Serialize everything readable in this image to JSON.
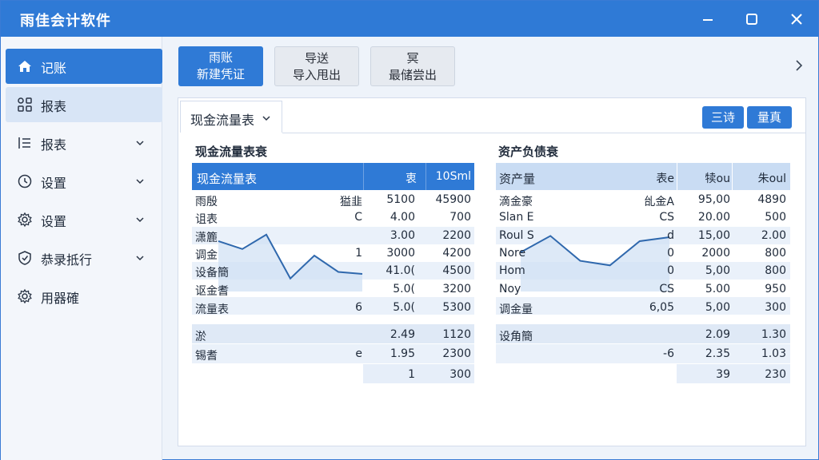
{
  "window": {
    "title": "雨佳会计软件",
    "controls": [
      "minimize-icon",
      "maximize-icon",
      "close-icon"
    ]
  },
  "sidebar": {
    "items": [
      {
        "label": "记账",
        "icon": "home-icon",
        "state": "active",
        "has_chevron": false
      },
      {
        "label": "报表",
        "icon": "grid-icon",
        "state": "selected",
        "has_chevron": false
      },
      {
        "label": "报表",
        "icon": "list-icon",
        "state": "normal",
        "has_chevron": true
      },
      {
        "label": "设置",
        "icon": "clock-icon",
        "state": "normal",
        "has_chevron": true
      },
      {
        "label": "设置",
        "icon": "gear-icon",
        "state": "normal",
        "has_chevron": true
      },
      {
        "label": "恭录抵行",
        "icon": "shield-icon",
        "state": "normal",
        "has_chevron": true
      },
      {
        "label": "用器確",
        "icon": "gear-icon",
        "state": "normal",
        "has_chevron": false
      }
    ]
  },
  "toolbar": {
    "new_voucher": {
      "line1": "雨账",
      "line2": "新建凭证"
    },
    "import_export": {
      "line1": "导送",
      "line2": "导入甩出"
    },
    "extra": {
      "line1": "冥",
      "line2": "最储尝出"
    }
  },
  "report": {
    "selector_label": "现金流量表",
    "btn_a": "三诗",
    "btn_b": "量真"
  },
  "cash_flow": {
    "section_title": "现金流量表衰",
    "header": [
      "现金流量表",
      "",
      "衷",
      "10Sml"
    ],
    "rows": [
      [
        "雨殷",
        "獈韭",
        "5100",
        "45900"
      ],
      [
        "诅表",
        "C",
        "4.00",
        "700"
      ],
      [
        "潇簏",
        "",
        "3.00",
        "2200"
      ],
      [
        "调金",
        "1",
        "3000",
        "4200"
      ],
      [
        "设备簡",
        "",
        "41.0(",
        "4500"
      ],
      [
        "讴金耆",
        "",
        "5.0(",
        "3200"
      ],
      [
        "流量表",
        "6",
        "5.0(",
        "5300"
      ]
    ],
    "totals": [
      [
        "淤",
        "",
        "2.49",
        "1120"
      ],
      [
        "锡耆",
        "e",
        "1.95",
        "2300"
      ],
      [
        "",
        "",
        "1",
        "300"
      ]
    ],
    "trend": [
      0.72,
      0.6,
      0.82,
      0.15,
      0.5,
      0.25,
      0.22
    ]
  },
  "balance_sheet": {
    "section_title": "资产负债衰",
    "header": [
      "资产量",
      "表e",
      "犊ou",
      "朱oul"
    ],
    "rows": [
      [
        "滴金豪",
        "乨金A",
        "95,00",
        "4890"
      ],
      [
        "Slan E",
        "CS",
        "20.00",
        "500"
      ],
      [
        "Roul S",
        "d",
        "15,00",
        "2.00"
      ],
      [
        "Nore",
        "0",
        "2000",
        "800"
      ],
      [
        "Hom",
        "0",
        "5,00",
        "800"
      ],
      [
        "Noy",
        "CS",
        "5.00",
        "950"
      ],
      [
        "调金量",
        "6,05",
        "5,00",
        "300"
      ]
    ],
    "totals": [
      [
        "设角簡",
        "",
        "2.09",
        "1.30"
      ],
      [
        "",
        "-6",
        "2.35",
        "1.03"
      ],
      [
        "",
        "",
        "39",
        "230"
      ]
    ],
    "trend": [
      0.55,
      0.8,
      0.42,
      0.35,
      0.72,
      0.78
    ]
  },
  "colors": {
    "accent": "#2f7ad6",
    "header_band": "#2f7ad6",
    "header_band_light": "#c9dcf3",
    "row_band": "#eaf1fa",
    "trend_line": "#2f68ad",
    "trend_fill": "#cfe0f4"
  }
}
